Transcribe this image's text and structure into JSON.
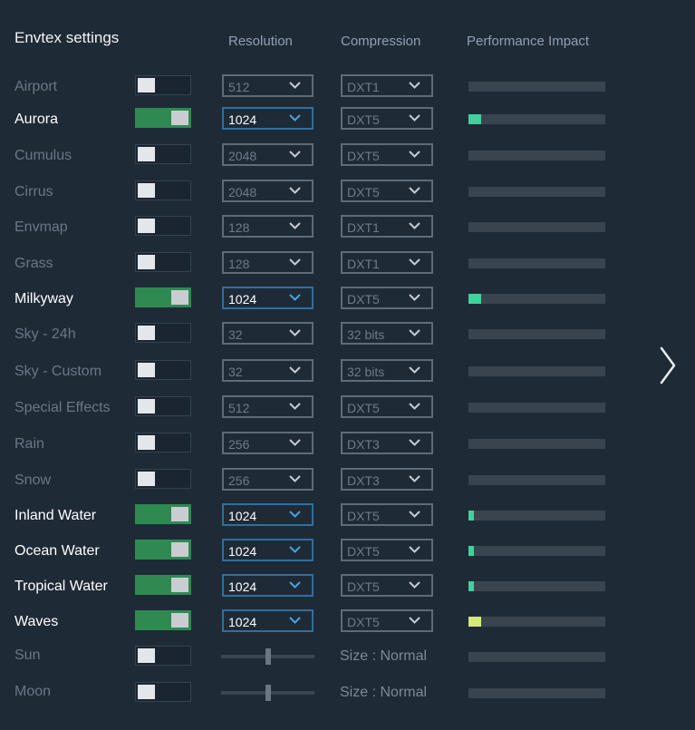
{
  "header": {
    "title": "Envtex settings",
    "col_resolution": "Resolution",
    "col_compression": "Compression",
    "col_performance": "Performance Impact"
  },
  "colors": {
    "background": "#1f2a37",
    "toggle_on": "#2f8a52",
    "impact_low": "#3fd29a",
    "impact_medium": "#d6e87a",
    "select_active_border": "#2f6f9e"
  },
  "rows": [
    {
      "label": "Airport",
      "enabled": false,
      "resolution": "512",
      "compression": "DXT1",
      "impact": 0
    },
    {
      "label": "Aurora",
      "enabled": true,
      "resolution": "1024",
      "compression": "DXT5",
      "impact": 0.09
    },
    {
      "label": "Cumulus",
      "enabled": false,
      "resolution": "2048",
      "compression": "DXT5",
      "impact": 0
    },
    {
      "label": "Cirrus",
      "enabled": false,
      "resolution": "2048",
      "compression": "DXT5",
      "impact": 0
    },
    {
      "label": "Envmap",
      "enabled": false,
      "resolution": "128",
      "compression": "DXT1",
      "impact": 0
    },
    {
      "label": "Grass",
      "enabled": false,
      "resolution": "128",
      "compression": "DXT1",
      "impact": 0
    },
    {
      "label": "Milkyway",
      "enabled": true,
      "resolution": "1024",
      "compression": "DXT5",
      "impact": 0.09
    },
    {
      "label": "Sky - 24h",
      "enabled": false,
      "resolution": "32",
      "compression": "32 bits",
      "impact": 0
    },
    {
      "label": "Sky - Custom",
      "enabled": false,
      "resolution": "32",
      "compression": "32 bits",
      "impact": 0
    },
    {
      "label": "Special Effects",
      "enabled": false,
      "resolution": "512",
      "compression": "DXT5",
      "impact": 0
    },
    {
      "label": "Rain",
      "enabled": false,
      "resolution": "256",
      "compression": "DXT3",
      "impact": 0
    },
    {
      "label": "Snow",
      "enabled": false,
      "resolution": "256",
      "compression": "DXT3",
      "impact": 0
    },
    {
      "label": "Inland Water",
      "enabled": true,
      "resolution": "1024",
      "compression": "DXT5",
      "impact": 0.04
    },
    {
      "label": "Ocean Water",
      "enabled": true,
      "resolution": "1024",
      "compression": "DXT5",
      "impact": 0.04
    },
    {
      "label": "Tropical Water",
      "enabled": true,
      "resolution": "1024",
      "compression": "DXT5",
      "impact": 0.04
    },
    {
      "label": "Waves",
      "enabled": true,
      "resolution": "1024",
      "compression": "DXT5",
      "impact": 0.09,
      "impact_level": "medium"
    }
  ],
  "size_rows": [
    {
      "label": "Sun",
      "enabled": false,
      "slider_value": 0.5,
      "size_text": "Size : Normal",
      "impact": 0
    },
    {
      "label": "Moon",
      "enabled": false,
      "slider_value": 0.5,
      "size_text": "Size : Normal",
      "impact": 0
    }
  ],
  "next_icon": "chevron-right-icon"
}
